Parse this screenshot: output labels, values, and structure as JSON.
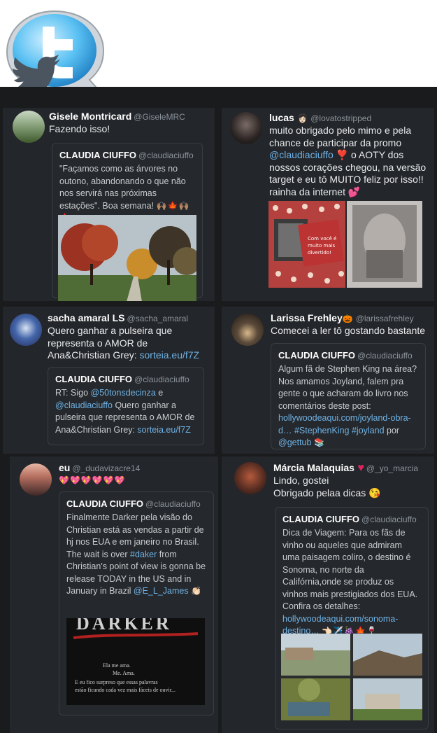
{
  "tweets": [
    {
      "name": "Gisele Montricard",
      "handle": "@GiseleMRC",
      "text": "Fazendo isso!",
      "quote": {
        "name": "CLAUDIA CIUFFO",
        "handle": "@claudiaciuffo",
        "text": "\"Façamos como as árvores no outono, abandonando o que não nos servirá nas próximas estações\". Boa semana!",
        "emoji": "🙌🏽🍁🙌🏽🍁"
      }
    },
    {
      "name": "lucas",
      "name_emoji": "👩🏻",
      "handle": "@lovatostripped",
      "text_1": "muito obrigado pelo mimo e pela chance de participar da promo",
      "mention": "@claudiaciuffo",
      "text_2": "❣️ o AOTY dos nossos corações chegou, na versão target e eu tô MUITO feliz por isso!! rainha da internet 💕",
      "image_caption": "Com você é muito mais divertido!"
    },
    {
      "name": "sacha amaral LS",
      "handle": "@sacha_amaral",
      "text": "Quero ganhar a pulseira que representa o AMOR de Ana&Christian Grey:",
      "link": "sorteia.eu/f7Z",
      "quote": {
        "name": "CLAUDIA CIUFFO",
        "handle": "@claudiaciuffo",
        "text_1": "RT: Sigo",
        "mention_1": "@50tonsdecinza",
        "text_2": "e",
        "mention_2": "@claudiaciuffo",
        "text_3": "Quero ganhar a pulseira que representa o AMOR de Ana&Christian Grey:",
        "link": "sorteia.eu/f7Z"
      }
    },
    {
      "name": "Larissa Frehley",
      "name_emoji": "🎃",
      "handle": "@larissafrehley",
      "text": "Comecei a ler tô gostando bastante",
      "quote": {
        "name": "CLAUDIA CIUFFO",
        "handle": "@claudiaciuffo",
        "text": "Algum fã de Stephen King na área? Nos amamos Joyland, falem pra gente o que acharam do livro nos comentários deste post:",
        "link": "hollywoodeaqui.com/joyland-obra-d…",
        "hashtag_1": "#StephenKing",
        "hashtag_2": "#joyland",
        "text_2": "por",
        "mention": "@gettub",
        "emoji": "📚"
      }
    },
    {
      "name": "eu",
      "handle": "@_dudavizacre14",
      "text": "💖💖💖💖💖💖",
      "quote": {
        "name": "CLAUDIA CIUFFO",
        "handle": "@claudiaciuffo",
        "text_1": "Finalmente Darker pela visão do Christian está as vendas a partir de hj nos EUA e em janeiro no Brasil. The wait is over",
        "hashtag": "#daker",
        "text_2": "from Christian's point of view is gonna be release TODAY in the US and in January in Brazil",
        "mention": "@E_L_James",
        "emoji": "👏🏻",
        "image_title": "DARKER",
        "image_line_1": "Ela me ama.",
        "image_line_2": "Me. Ama.",
        "image_line_3": "E eu fico surpreso que essas palavras",
        "image_line_4": "estão ficando cada vez mais fáceis de ouvir..."
      }
    },
    {
      "name": "Márcia Malaquias",
      "name_emoji": "♥",
      "handle": "@_yo_marcia",
      "text_1": "Lindo, gostei",
      "text_2": "Obrigado pelaa dicas 😘",
      "quote": {
        "name": "CLAUDIA CIUFFO",
        "handle": "@claudiaciuffo",
        "text": "Dica de Viagem: Para os fãs de vinho ou aqueles que admiram uma paisagem coliro, o destino é Sonoma, no norte da Califórnia,onde se produz os vinhos mais prestigiados dos EUA. Confira os detalhes:",
        "link": "hollywoodeaqui.com/sonoma-destino…",
        "emoji": "👈🏻✈️🍇🍁🍷"
      }
    }
  ],
  "colors": {
    "background": "#1a1b1d",
    "card": "#23262a",
    "link": "#6fb3e6",
    "logo": "#2e9ee0"
  }
}
